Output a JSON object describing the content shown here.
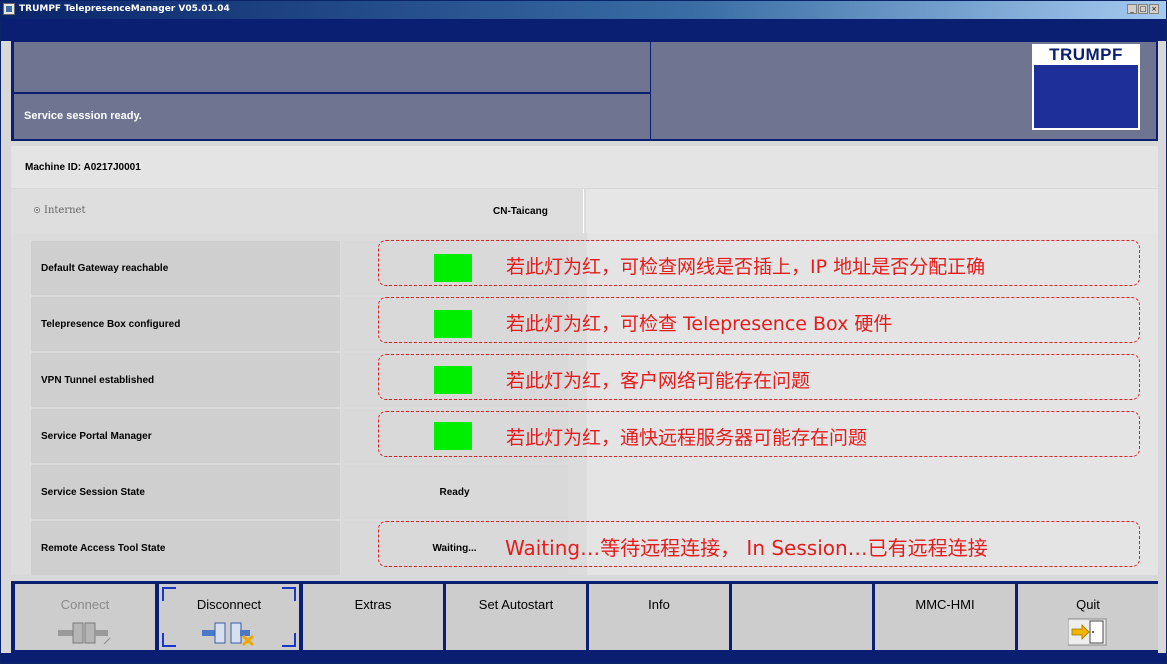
{
  "window": {
    "title": "TRUMPF TelepresenceManager V05.01.04",
    "minimize_label": "_",
    "maximize_label": "□",
    "close_label": "×"
  },
  "header": {
    "status": "Service session ready.",
    "logo_text": "TRUMPF"
  },
  "machine": {
    "id_label": "Machine ID: A0217J0001"
  },
  "connection": {
    "type_label": "Internet",
    "location": "CN-Taicang"
  },
  "status_rows": [
    {
      "label": "Default Gateway reachable",
      "value": "",
      "led": "green"
    },
    {
      "label": "Telepresence Box configured",
      "value": "",
      "led": "green"
    },
    {
      "label": "VPN Tunnel established",
      "value": "",
      "led": "green"
    },
    {
      "label": "Service Portal Manager",
      "value": "",
      "led": "green"
    },
    {
      "label": "Service Session State",
      "value": "Ready",
      "led": ""
    },
    {
      "label": "Remote Access Tool State",
      "value": "Waiting...",
      "led": ""
    }
  ],
  "annotations": [
    "若此灯为红，可检查网线是否插上，IP 地址是否分配正确",
    "若此灯为红，可检查 Telepresence Box 硬件",
    "若此灯为红，客户网络可能存在问题",
    "若此灯为红，通快远程服务器可能存在问题",
    "Waiting…等待远程连接， In Session…已有远程连接"
  ],
  "toolbar": {
    "buttons": [
      {
        "label": "Connect",
        "enabled": false,
        "icon": "plug-connect-icon"
      },
      {
        "label": "Disconnect",
        "enabled": true,
        "selected": true,
        "icon": "plug-disconnect-icon"
      },
      {
        "label": "Extras",
        "enabled": true
      },
      {
        "label": "Set Autostart",
        "enabled": true
      },
      {
        "label": "Info",
        "enabled": true
      },
      {
        "label": "",
        "enabled": false
      },
      {
        "label": "MMC-HMI",
        "enabled": true
      },
      {
        "label": "Quit",
        "enabled": true,
        "icon": "exit-door-icon"
      }
    ]
  },
  "colors": {
    "navy": "#0a1f72",
    "header_gray": "#6f7591",
    "led_green": "#00ee00",
    "annotation_red": "#e41c1c",
    "selection_blue": "#1c37c7"
  }
}
